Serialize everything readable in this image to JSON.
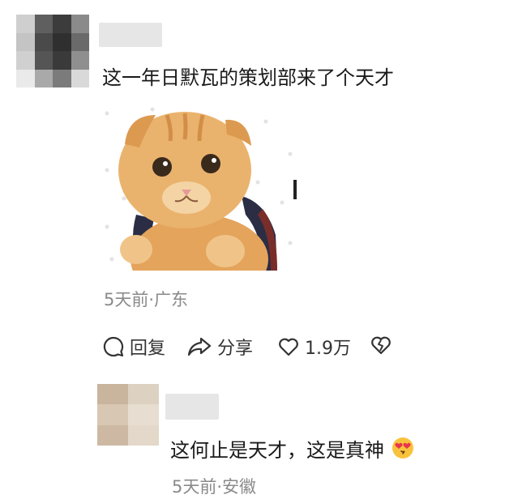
{
  "comment": {
    "avatar_colors": [
      "#cfcfcf",
      "#5f5f5f",
      "#3c3c3c",
      "#8a8a8a",
      "#c4c4c4",
      "#4a4a4a",
      "#2f2f2f",
      "#6a6a6a",
      "#d0d0d0",
      "#555",
      "#3a3a3a",
      "#8f8f8f",
      "#eaeaea",
      "#a9a9a9",
      "#7b7b7b",
      "#d9d9d9"
    ],
    "text": "这一年日默瓦的策划部来了个天才",
    "sticker_icon": "orange-cat-with-backpack-sticker",
    "meta": "5天前·广东",
    "actions": {
      "reply_label": "回复",
      "share_label": "分享",
      "like_count": "1.9万",
      "dislike_icon": "broken-heart-icon"
    }
  },
  "reply": {
    "avatar_colors": [
      "#c9b49d",
      "#ddd1c2",
      "#d8c7b3",
      "#e7ddd0",
      "#cdb9a3",
      "#e3d8c9"
    ],
    "text": "这何止是天才，这是真神",
    "emoji_icon": "heart-eyes-emoji",
    "meta": "5天前·安徽"
  }
}
